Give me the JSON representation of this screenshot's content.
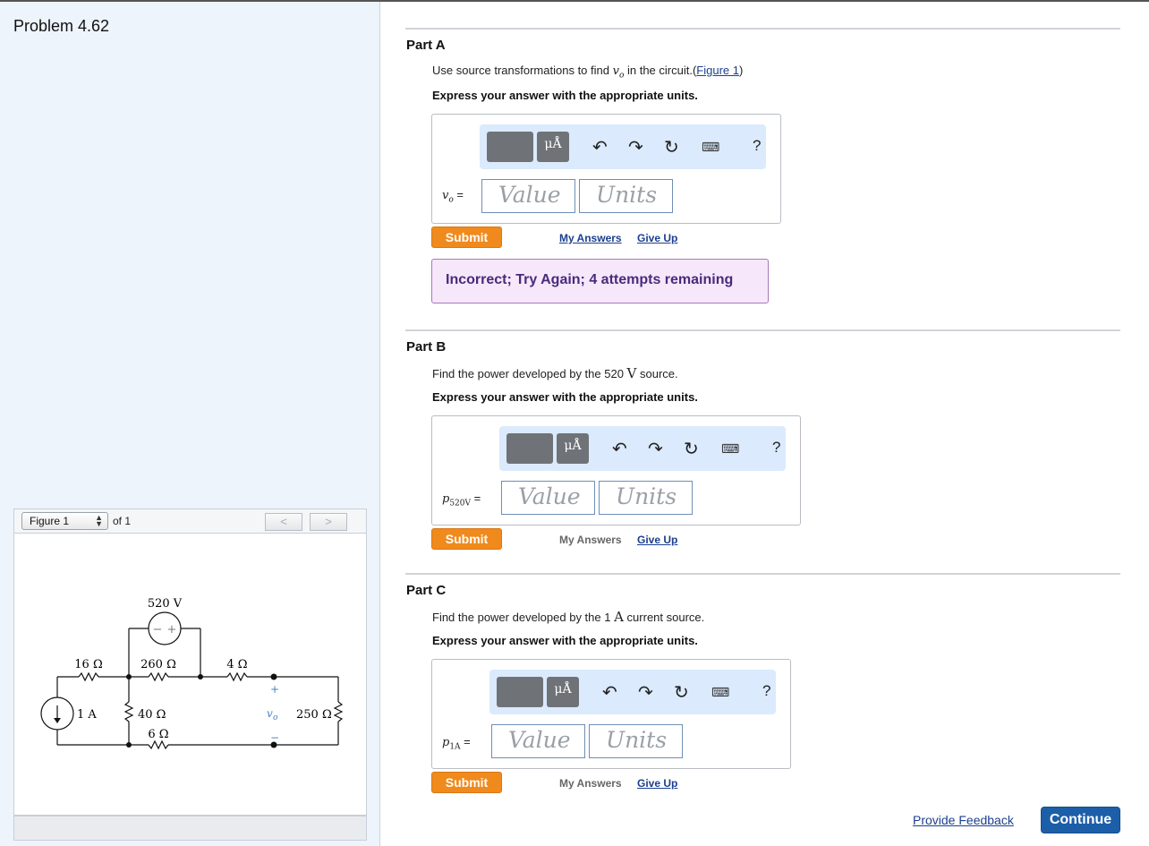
{
  "problem": {
    "title": "Problem 4.62"
  },
  "figure_panel": {
    "select_value": "Figure 1",
    "of_text": "of 1",
    "prev_label": "<",
    "next_label": ">",
    "circuit": {
      "source_voltage": "520 V",
      "source_polarity_minus": "−",
      "source_polarity_plus": "+",
      "r1": "16 Ω",
      "r2": "260 Ω",
      "r3": "4 Ω",
      "r4": "40 Ω",
      "r5": "6 Ω",
      "r6": "250 Ω",
      "current_source": "1 A",
      "vo_label": "v",
      "vo_sub": "o",
      "plus": "+",
      "minus": "−"
    }
  },
  "part_a": {
    "title": "Part A",
    "prompt_pre": "Use source transformations to find ",
    "prompt_var": "v",
    "prompt_var_sub": "o",
    "prompt_post": " in the circuit.(",
    "prompt_link": "Figure 1",
    "prompt_close": ")",
    "instruction": "Express your answer with the appropriate units.",
    "label": "v",
    "label_sub": "o",
    "label_eq": " =",
    "value_placeholder": "Value",
    "units_placeholder": "Units",
    "submit": "Submit",
    "my_answers": "My Answers",
    "give_up": "Give Up",
    "feedback": "Incorrect; Try Again; 4 attempts remaining"
  },
  "part_b": {
    "title": "Part B",
    "prompt_pre": "Find the power developed by the 520 ",
    "prompt_unit": "V",
    "prompt_post": " source.",
    "instruction": "Express your answer with the appropriate units.",
    "label": "p",
    "label_sub": "520V",
    "label_eq": " =",
    "value_placeholder": "Value",
    "units_placeholder": "Units",
    "submit": "Submit",
    "my_answers": "My Answers",
    "give_up": "Give Up"
  },
  "part_c": {
    "title": "Part C",
    "prompt_pre": "Find the power developed by the 1 ",
    "prompt_unit": "A",
    "prompt_post": " current source.",
    "instruction": "Express your answer with the appropriate units.",
    "label": "p",
    "label_sub": "1A",
    "label_eq": " =",
    "value_placeholder": "Value",
    "units_placeholder": "Units",
    "submit": "Submit",
    "my_answers": "My Answers",
    "give_up": "Give Up"
  },
  "toolbar": {
    "units_symbol": "μÅ",
    "undo_icon": "↶",
    "redo_icon": "↷",
    "reset_icon": "↻",
    "keyboard_icon": "⌨",
    "help": "?"
  },
  "footer": {
    "provide_feedback": "Provide Feedback",
    "continue": "Continue"
  }
}
